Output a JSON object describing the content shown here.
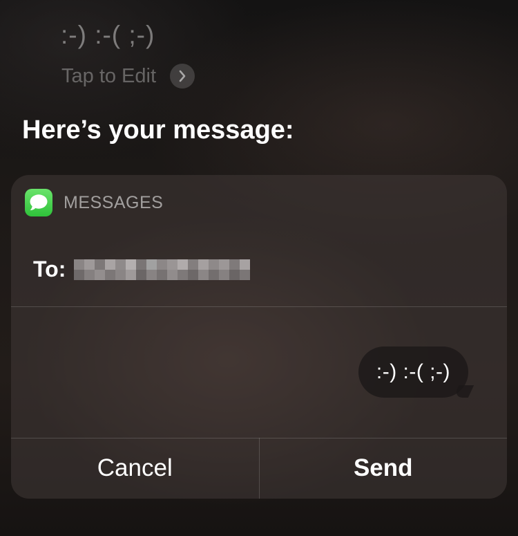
{
  "siri": {
    "transcript": ":-) :-( ;-)",
    "tap_to_edit": "Tap to Edit",
    "response": "Here’s your message:"
  },
  "card": {
    "app_name": "MESSAGES",
    "to_label": "To:",
    "message_text": ":-) :-( ;-)",
    "cancel_label": "Cancel",
    "send_label": "Send"
  },
  "icons": {
    "edit_chevron": "chevron-right-icon",
    "app_icon": "messages-app-icon"
  },
  "colors": {
    "messages_green": "#34c759"
  }
}
